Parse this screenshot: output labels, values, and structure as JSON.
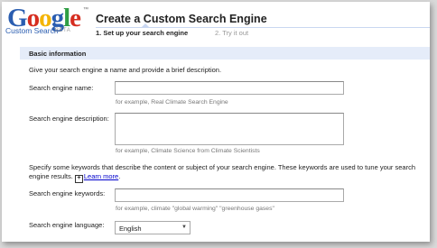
{
  "logo": {
    "letters": [
      "G",
      "o",
      "o",
      "g",
      "l",
      "e"
    ],
    "trademark": "™",
    "subtitle": "Custom Search",
    "beta": "BETA"
  },
  "header": {
    "title": "Create a Custom Search Engine",
    "step1": "1. Set up your search engine",
    "step2": "2. Try it out"
  },
  "section": {
    "title": "Basic information",
    "intro": "Give your search engine a name and provide a brief description."
  },
  "fields": {
    "name_label": "Search engine name:",
    "name_value": "",
    "name_hint": "for example, Real Climate Search Engine",
    "description_label": "Search engine description:",
    "description_value": "",
    "description_hint": "for example, Climate Science from Climate Scientists",
    "keywords_intro_line1": "Specify some keywords that describe the content or subject of your search engine. These keywords are used to tune your search",
    "keywords_intro_line2": "engine results.",
    "learn_more": "Learn more",
    "keywords_label": "Search engine keywords:",
    "keywords_value": "",
    "keywords_hint": "for example, climate \"global warming\" \"greenhouse gases\"",
    "language_label": "Search engine language:",
    "language_value": "English"
  },
  "colors": {
    "section_bar": "#e5ecf9",
    "link": "#0000cc"
  }
}
